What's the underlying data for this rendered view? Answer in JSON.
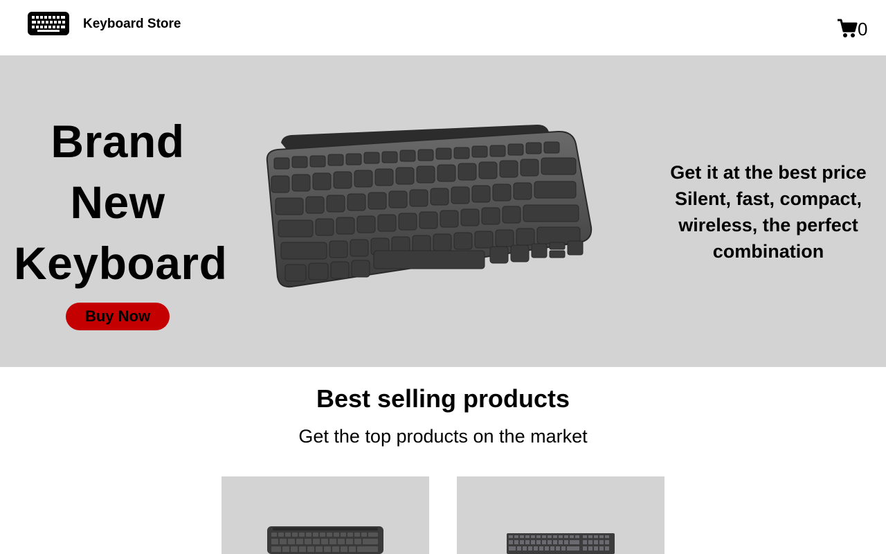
{
  "header": {
    "logo_icon": "keyboard-icon",
    "brand_name": "Keyboard Store",
    "cart_icon": "cart-icon",
    "cart_count": "0"
  },
  "hero": {
    "title_lines": [
      "Brand",
      "New",
      "Keyboard"
    ],
    "buy_button": "Buy Now",
    "tagline_lines": [
      "Get it at the best price",
      "Silent, fast, compact,",
      "wireless, the perfect",
      "combination"
    ],
    "background": "#d3d3d3",
    "button_color": "#c40000"
  },
  "products": {
    "title": "Best selling products",
    "subtitle": "Get the top products on the market",
    "items": [
      {
        "image": "compact-keyboard-image"
      },
      {
        "image": "full-size-keyboard-image"
      }
    ]
  }
}
